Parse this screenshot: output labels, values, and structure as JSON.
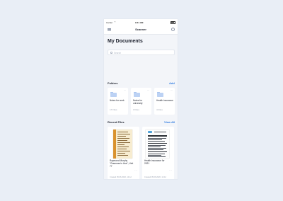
{
  "status_bar": {
    "carrier": "Carrier",
    "time": "9:41 AM"
  },
  "nav": {
    "title": "Scanner",
    "menu_icon": "menu-icon",
    "profile_icon": "profile-icon"
  },
  "page_title": "My Documents",
  "search": {
    "placeholder": "Search"
  },
  "folders": {
    "title": "Folders",
    "action": "Add",
    "items": [
      {
        "name": "Notes for work",
        "count": "17 Files"
      },
      {
        "name": "Notes for university",
        "count": "3 Files"
      },
      {
        "name": "Health insurance",
        "count": "4 Files"
      }
    ]
  },
  "recent": {
    "title": "Recent Files",
    "action": "View All",
    "items": [
      {
        "name": "Raymond Murphy \"Grammar in Use\", Unit 77",
        "date": "Created 05.06.2020, 14:12"
      },
      {
        "name": "Health insurance for 2021",
        "date": "Created 05.06.2020, 14:12"
      }
    ]
  },
  "tabbar": {
    "left_icon": "folder-icon",
    "center_icon": "scan-icon",
    "right_icon": "settings-icon"
  },
  "colors": {
    "accent": "#2f7be0",
    "background": "#e9eef6",
    "surface": "#f3f5f9",
    "folder": "#bcd2f4"
  }
}
